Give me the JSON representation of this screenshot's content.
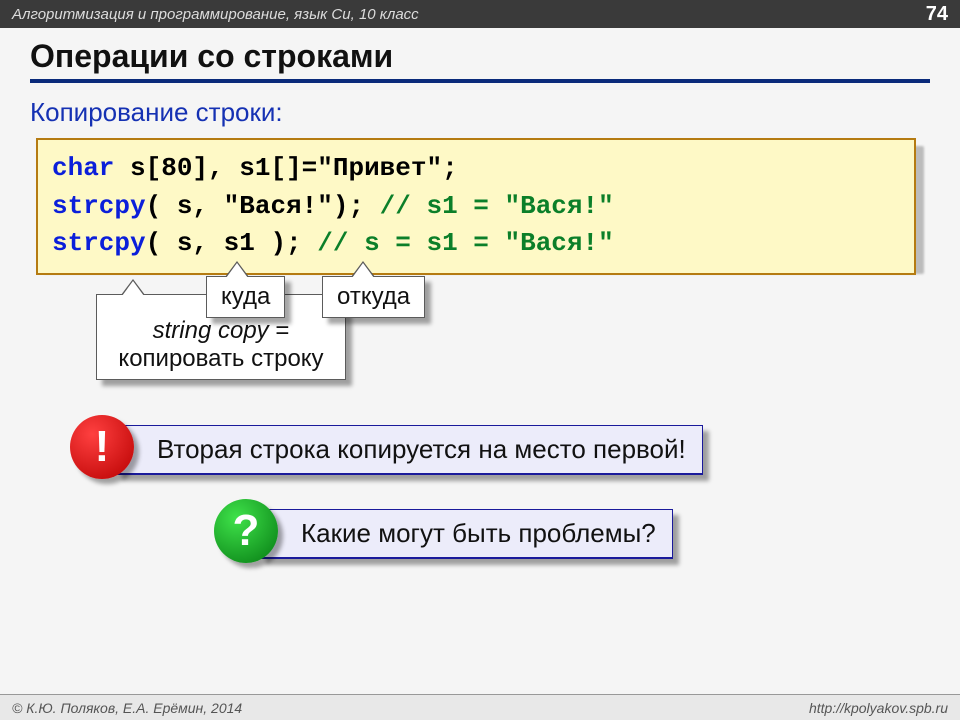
{
  "topbar": {
    "course": "Алгоритмизация и программирование, язык Си, 10 класс",
    "page": "74"
  },
  "title": "Операции со строками",
  "subhead": "Копирование строки:",
  "code": {
    "l1_kw": "char",
    "l1_rest": " s[80], s1[]=\"Привет\";",
    "l2_fn": "strcpy",
    "l2_args": "( s, \"Вася!\"); ",
    "l2_cmt": "// s1 = \"Вася!\"",
    "l3_fn": "strcpy",
    "l3_args": "( s, s1 );    ",
    "l3_cmt": "// s = s1 = \"Вася!\""
  },
  "labels": {
    "kuda": "куда",
    "otkuda": "откуда",
    "strcpy_ital": "string copy",
    "strcpy_dash": " = ",
    "strcpy_rest": "копировать строку"
  },
  "notes": {
    "bang": "!",
    "bang_text": "Вторая строка копируется на место первой!",
    "q": "?",
    "q_text": "Какие могут быть проблемы?"
  },
  "footer": {
    "left": "© К.Ю. Поляков, Е.А. Ерёмин, 2014",
    "right": "http://kpolyakov.spb.ru"
  }
}
